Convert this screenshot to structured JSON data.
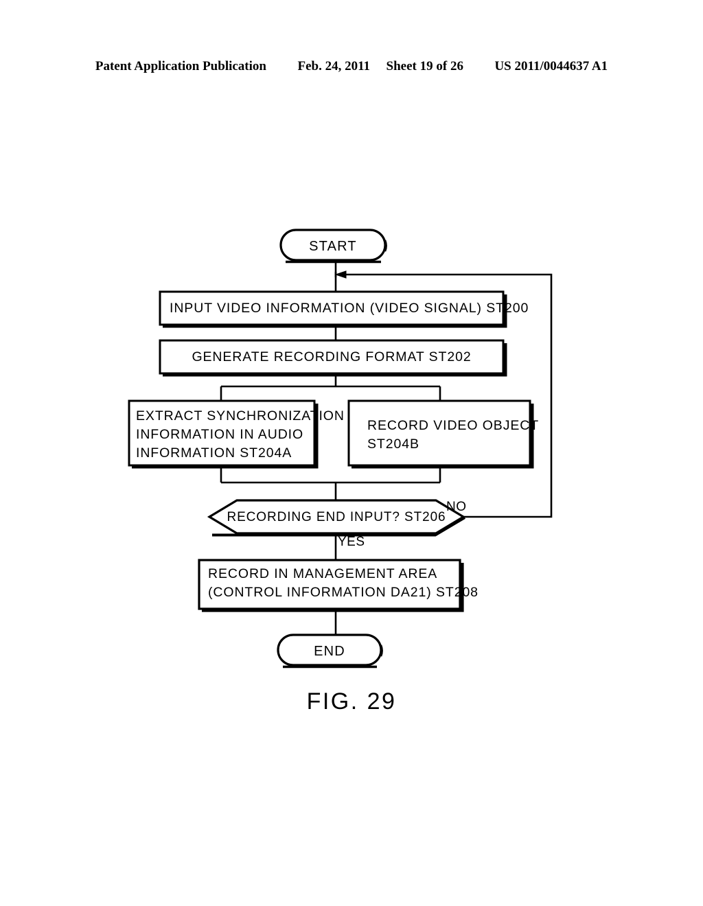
{
  "header": {
    "publication": "Patent Application Publication",
    "date": "Feb. 24, 2011",
    "sheet": "Sheet 19 of 26",
    "patent_number": "US 2011/0044637 A1"
  },
  "figure": {
    "caption": "FIG. 29"
  },
  "flowchart": {
    "start": {
      "label": "START"
    },
    "step_st200": {
      "label": "INPUT VIDEO INFORMATION (VIDEO SIGNAL) ST200"
    },
    "step_st202": {
      "label": "GENERATE RECORDING FORMAT ST202"
    },
    "step_st204a": {
      "line1": "EXTRACT SYNCHRONIZATION",
      "line2": "INFORMATION IN AUDIO",
      "line3": "INFORMATION ST204A"
    },
    "step_st204b": {
      "line1": "RECORD VIDEO OBJECT",
      "line2": "ST204B"
    },
    "decision_st206": {
      "label": "RECORDING END INPUT? ST206",
      "branch_no": "NO",
      "branch_yes": "YES"
    },
    "step_st208": {
      "line1": "RECORD IN MANAGEMENT AREA",
      "line2": "(CONTROL INFORMATION DA21) ST208"
    },
    "end": {
      "label": "END"
    }
  },
  "colors": {
    "ink": "#000000",
    "paper": "#ffffff"
  }
}
